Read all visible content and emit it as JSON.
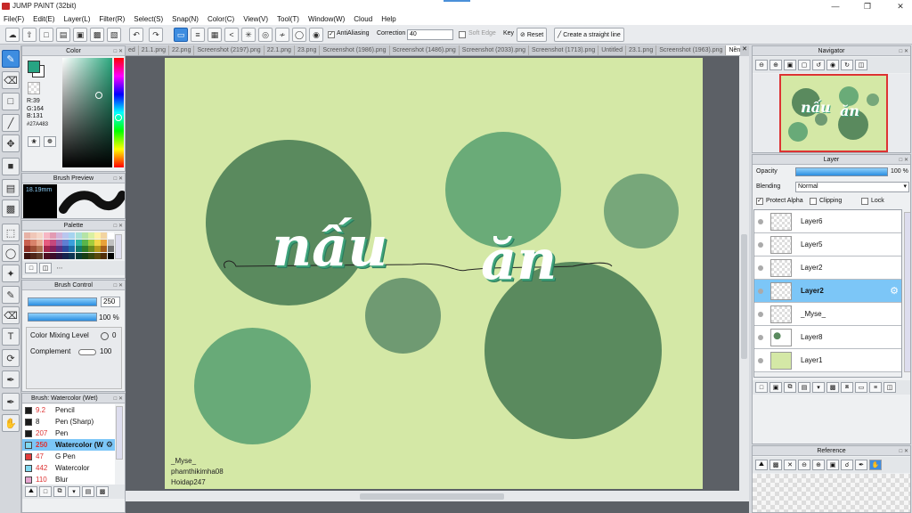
{
  "window": {
    "title": "JUMP PAINT (32bit)",
    "controls": [
      "—",
      "❐",
      "✕"
    ]
  },
  "menu": [
    "File(F)",
    "Edit(E)",
    "Layer(L)",
    "Filter(R)",
    "Select(S)",
    "Snap(N)",
    "Color(C)",
    "View(V)",
    "Tool(T)",
    "Window(W)",
    "Cloud",
    "Help"
  ],
  "toolbar": {
    "antialiasing_label": "AntiAliasing",
    "correction_label": "Correction",
    "correction_value": "40",
    "soft_edge_label": "Soft Edge",
    "key_label": "Key",
    "reset_label": "Reset",
    "straight_line_label": "Create a straight line"
  },
  "color_panel": {
    "title": "Color",
    "r": "R:39",
    "g": "G:164",
    "b": "B:131",
    "hex": "#27A483",
    "current_color": "#27A483"
  },
  "brush_preview": {
    "title": "Brush Preview",
    "size": "18.19mm"
  },
  "palette": {
    "title": "Palette",
    "colors": [
      "#e7b2a6",
      "#f0c7b8",
      "#f5d6c8",
      "#f7b7c4",
      "#e39bb3",
      "#d3b4d8",
      "#b9c6ee",
      "#a6d4f0",
      "#a7e0d6",
      "#b5e3a6",
      "#d9f0a1",
      "#fff1a6",
      "#f2d4a1",
      "#ffffff",
      "#c9604f",
      "#d8836b",
      "#e8a98d",
      "#e65b7e",
      "#c5487d",
      "#9266b2",
      "#5f7fd2",
      "#3aa0dc",
      "#2fb39e",
      "#59b54a",
      "#a3cc3d",
      "#f3d547",
      "#e8a13a",
      "#c0c0c0",
      "#8c2f25",
      "#9e4e36",
      "#b27251",
      "#a3254b",
      "#86205c",
      "#5a2f83",
      "#2c4a9e",
      "#1b6fa8",
      "#127a6b",
      "#2f7d2a",
      "#6b8d1f",
      "#b59a1d",
      "#a65f1b",
      "#6e6e6e",
      "#3f1410",
      "#4f2618",
      "#5e3a27",
      "#4e0f22",
      "#3c0c2a",
      "#2a1440",
      "#14244e",
      "#0d3552",
      "#083c34",
      "#173e14",
      "#35460f",
      "#59490c",
      "#512e0c",
      "#000000"
    ]
  },
  "brush_control": {
    "title": "Brush Control",
    "size_value": "250",
    "opacity_value": "100 %",
    "color_mixing_label": "Color Mixing Level",
    "color_mixing_value": "0",
    "complement_label": "Complement",
    "complement_value": "100"
  },
  "brush_list": {
    "title": "Brush: Watercolor (Wet)",
    "items": [
      {
        "size": "9.2",
        "name": "Pencil",
        "color": "#1a1a1a"
      },
      {
        "size": "8",
        "name": "Pen (Sharp)",
        "color": "#1a1a1a"
      },
      {
        "size": "207",
        "name": "Pen",
        "color": "#1a1a1a"
      },
      {
        "size": "250",
        "name": "Watercolor (W",
        "color": "#7fd8f0"
      },
      {
        "size": "47",
        "name": "G Pen",
        "color": "#e33b3b"
      },
      {
        "size": "442",
        "name": "Watercolor",
        "color": "#7fd8f0"
      },
      {
        "size": "110",
        "name": "Blur",
        "color": "#e6a6d0"
      }
    ]
  },
  "doc_tabs": [
    "ed",
    "21.1.png",
    "22.png",
    "Screenshot (2197).png",
    "22.1.png",
    "23.png",
    "Screenshot (1986).png",
    "Screenshot (1486).png",
    "Screenshot (2033).png",
    "Screenshot (1713).png",
    "Untitled",
    "23.1.png",
    "Screenshot (1963).png",
    "Nền.png"
  ],
  "artwork": {
    "title_word1": "nấu",
    "title_word2": "ăn",
    "credits": [
      "_Myse_",
      "phamthikimha08",
      "Hoidap247"
    ],
    "bg_color": "#d4e8a6"
  },
  "navigator": {
    "title": "Navigator"
  },
  "layer_panel": {
    "title": "Layer",
    "opacity_label": "Opacity",
    "opacity_value": "100 %",
    "blending_label": "Blending",
    "blending_value": "Normal",
    "protect_alpha_label": "Protect Alpha",
    "clipping_label": "Clipping",
    "lock_label": "Lock",
    "layers": [
      {
        "name": "Layer6",
        "selected": false
      },
      {
        "name": "Layer5",
        "selected": false
      },
      {
        "name": "Layer2",
        "selected": false
      },
      {
        "name": "Layer2",
        "selected": true
      },
      {
        "name": "_Myse_",
        "selected": false
      },
      {
        "name": "Layer8",
        "selected": false
      },
      {
        "name": "Layer1",
        "selected": false
      }
    ]
  },
  "reference": {
    "title": "Reference"
  },
  "icons": {
    "undo": "↶",
    "redo": "↷",
    "pencil": "✎",
    "eraser": "⌫",
    "move": "✥",
    "hand": "✋",
    "text": "T",
    "gear": "⚙",
    "eyedropper": "✒",
    "fill": "▤"
  }
}
